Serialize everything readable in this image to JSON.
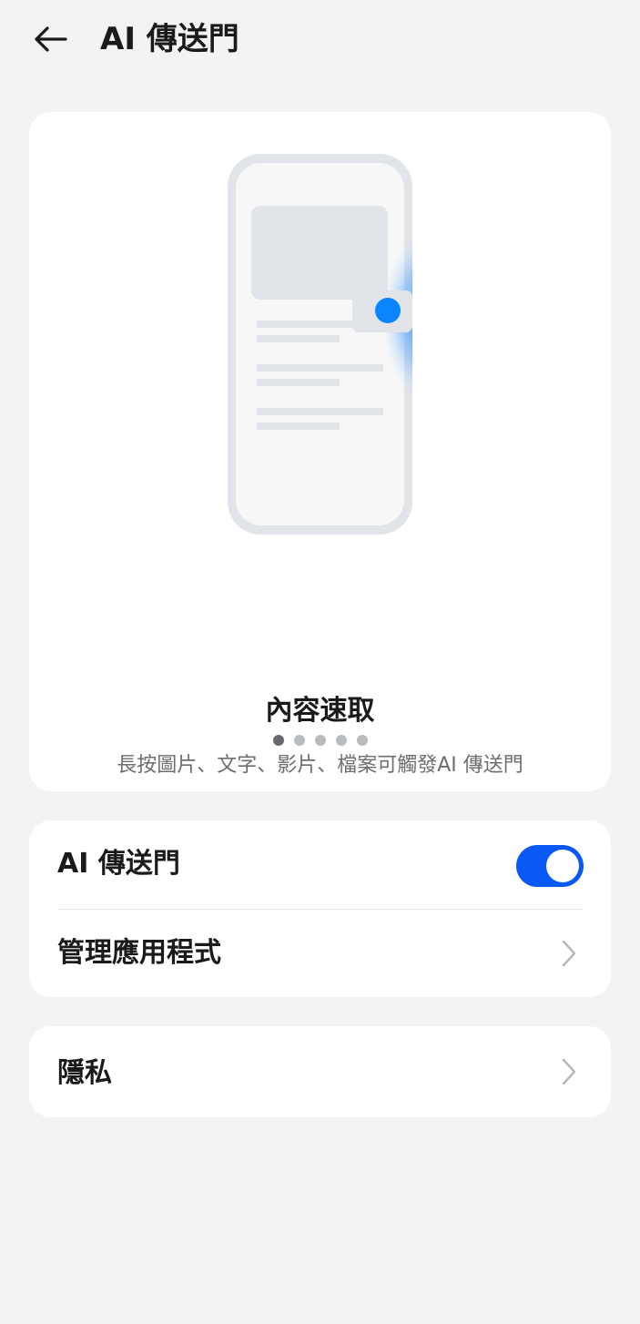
{
  "header": {
    "title": "AI 傳送門",
    "back_icon": "arrow-left-icon"
  },
  "intro": {
    "title": "內容速取",
    "description": "長按圖片、文字、影片、檔案可觸發AI 傳送門",
    "pager": {
      "count": 5,
      "active_index": 0
    }
  },
  "settings": {
    "ai_portal_label": "AI 傳送門",
    "ai_portal_enabled": true,
    "manage_apps_label": "管理應用程式"
  },
  "privacy": {
    "label": "隱私"
  },
  "colors": {
    "background": "#f1f3f5",
    "card": "#ffffff",
    "accent": "#0a59f7",
    "illustration_dot": "#0a84ff"
  }
}
